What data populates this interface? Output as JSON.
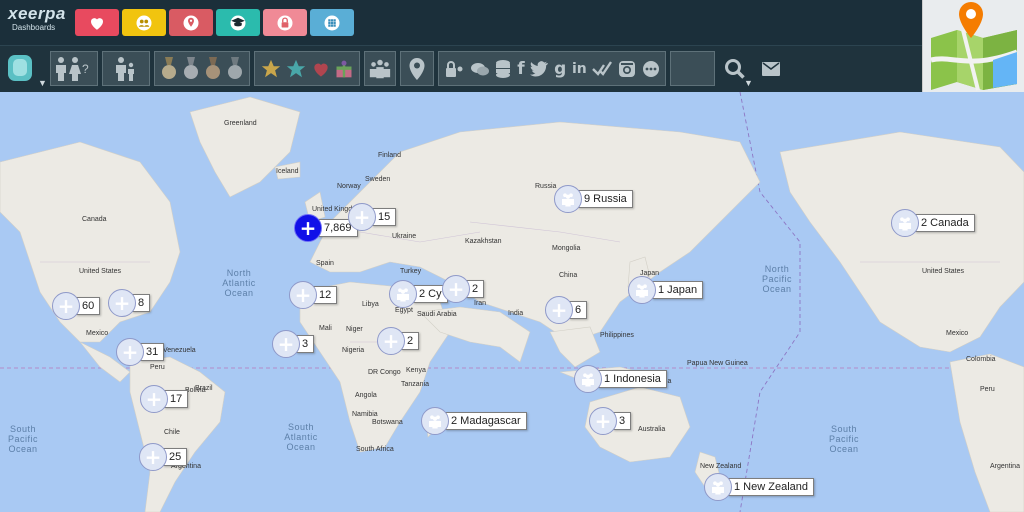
{
  "app": {
    "logo_line1": "xeerpa",
    "logo_line2": "Dashboards"
  },
  "topbar": {
    "buttons": [
      {
        "icon": "heart-icon",
        "color": "#e84a5f"
      },
      {
        "icon": "group-icon",
        "color": "#f1c40f"
      },
      {
        "icon": "map-pin-icon",
        "color": "#e0626a"
      },
      {
        "icon": "graduate-icon",
        "color": "#2bbbad"
      },
      {
        "icon": "lock-icon",
        "color": "#f08a96"
      },
      {
        "icon": "grid-icon",
        "color": "#5aaed6"
      }
    ]
  },
  "map": {
    "region_labels": [
      {
        "name": "Greenland",
        "text": "Greenland"
      },
      {
        "name": "Iceland",
        "text": "Iceland"
      },
      {
        "name": "Finland",
        "text": "Finland"
      },
      {
        "name": "Norway",
        "text": "Norway"
      },
      {
        "name": "Sweden",
        "text": "Sweden"
      },
      {
        "name": "United Kingdom",
        "text": "United Kingdom"
      },
      {
        "name": "Ukraine",
        "text": "Ukraine"
      },
      {
        "name": "Russia",
        "text": "Russia"
      },
      {
        "name": "Kazakhstan",
        "text": "Kazakhstan"
      },
      {
        "name": "Mongolia",
        "text": "Mongolia"
      },
      {
        "name": "China",
        "text": "China"
      },
      {
        "name": "Japan",
        "text": "Japan"
      },
      {
        "name": "Spain",
        "text": "Spain"
      },
      {
        "name": "Turkey",
        "text": "Turkey"
      },
      {
        "name": "Iran",
        "text": "Iran"
      },
      {
        "name": "India",
        "text": "India"
      },
      {
        "name": "Libya",
        "text": "Libya"
      },
      {
        "name": "Egypt",
        "text": "Egypt"
      },
      {
        "name": "Saudi Arabia",
        "text": "Saudi Arabia"
      },
      {
        "name": "Mali",
        "text": "Mali"
      },
      {
        "name": "Niger",
        "text": "Niger"
      },
      {
        "name": "Nigeria",
        "text": "Nigeria"
      },
      {
        "name": "DR Congo",
        "text": "DR Congo"
      },
      {
        "name": "Kenya",
        "text": "Kenya"
      },
      {
        "name": "Tanzania",
        "text": "Tanzania"
      },
      {
        "name": "Angola",
        "text": "Angola"
      },
      {
        "name": "Namibia",
        "text": "Namibia"
      },
      {
        "name": "Botswana",
        "text": "Botswana"
      },
      {
        "name": "South Africa",
        "text": "South Africa"
      },
      {
        "name": "Canada (west)",
        "text": "Canada"
      },
      {
        "name": "United States (west)",
        "text": "United States"
      },
      {
        "name": "Mexico (west)",
        "text": "Mexico"
      },
      {
        "name": "Venezuela",
        "text": "Venezuela"
      },
      {
        "name": "Peru",
        "text": "Peru"
      },
      {
        "name": "Brazil",
        "text": "Brazil"
      },
      {
        "name": "Bolivia",
        "text": "Bolivia"
      },
      {
        "name": "Chile",
        "text": "Chile"
      },
      {
        "name": "Argentina (west)",
        "text": "Argentina"
      },
      {
        "name": "Indonesia",
        "text": "Indonesia"
      },
      {
        "name": "Australia",
        "text": "Australia"
      },
      {
        "name": "New Zealand",
        "text": "New Zealand"
      },
      {
        "name": "Papua New Guinea",
        "text": "Papua New Guinea"
      },
      {
        "name": "Philippines",
        "text": "Philippines"
      },
      {
        "name": "United States (east)",
        "text": "United States"
      },
      {
        "name": "Mexico (east)",
        "text": "Mexico"
      },
      {
        "name": "Colombia",
        "text": "Colombia"
      },
      {
        "name": "Peru (east)",
        "text": "Peru"
      },
      {
        "name": "Argentina (east)",
        "text": "Argentina"
      }
    ],
    "oceans": [
      {
        "name": "North Atlantic",
        "text": "North Atlantic Ocean"
      },
      {
        "name": "South Atlantic",
        "text": "South Atlantic Ocean"
      },
      {
        "name": "North Pacific",
        "text": "North Pacific Ocean"
      },
      {
        "name": "South Pacific (west)",
        "text": "South Pacific Ocean"
      },
      {
        "name": "South Pacific (east)",
        "text": "South Pacific Ocean"
      }
    ],
    "markers": [
      {
        "id": "m-7869",
        "label": "7,869",
        "style": "blue"
      },
      {
        "id": "m-15",
        "label": "15",
        "style": "plus"
      },
      {
        "id": "m-russia",
        "label": "9 Russia",
        "style": "people"
      },
      {
        "id": "m-canada",
        "label": "2 Canada",
        "style": "people"
      },
      {
        "id": "m-60",
        "label": "60",
        "style": "plus"
      },
      {
        "id": "m-8",
        "label": "8",
        "style": "plus"
      },
      {
        "id": "m-12",
        "label": "12",
        "style": "plus"
      },
      {
        "id": "m-cyprus",
        "label": "2 Cy",
        "style": "people"
      },
      {
        "id": "m-2a",
        "label": "2",
        "style": "plus"
      },
      {
        "id": "m-6",
        "label": "6",
        "style": "plus"
      },
      {
        "id": "m-japan",
        "label": "1 Japan",
        "style": "people"
      },
      {
        "id": "m-31",
        "label": "31",
        "style": "plus"
      },
      {
        "id": "m-3a",
        "label": "3",
        "style": "plus"
      },
      {
        "id": "m-2b",
        "label": "2",
        "style": "plus"
      },
      {
        "id": "m-indonesia",
        "label": "1 Indonesia",
        "style": "people"
      },
      {
        "id": "m-17",
        "label": "17",
        "style": "plus"
      },
      {
        "id": "m-madagascar",
        "label": "2 Madagascar",
        "style": "people"
      },
      {
        "id": "m-3b",
        "label": "3",
        "style": "plus"
      },
      {
        "id": "m-25",
        "label": "25",
        "style": "plus"
      },
      {
        "id": "m-nz",
        "label": "1 New Zealand",
        "style": "people"
      }
    ]
  }
}
